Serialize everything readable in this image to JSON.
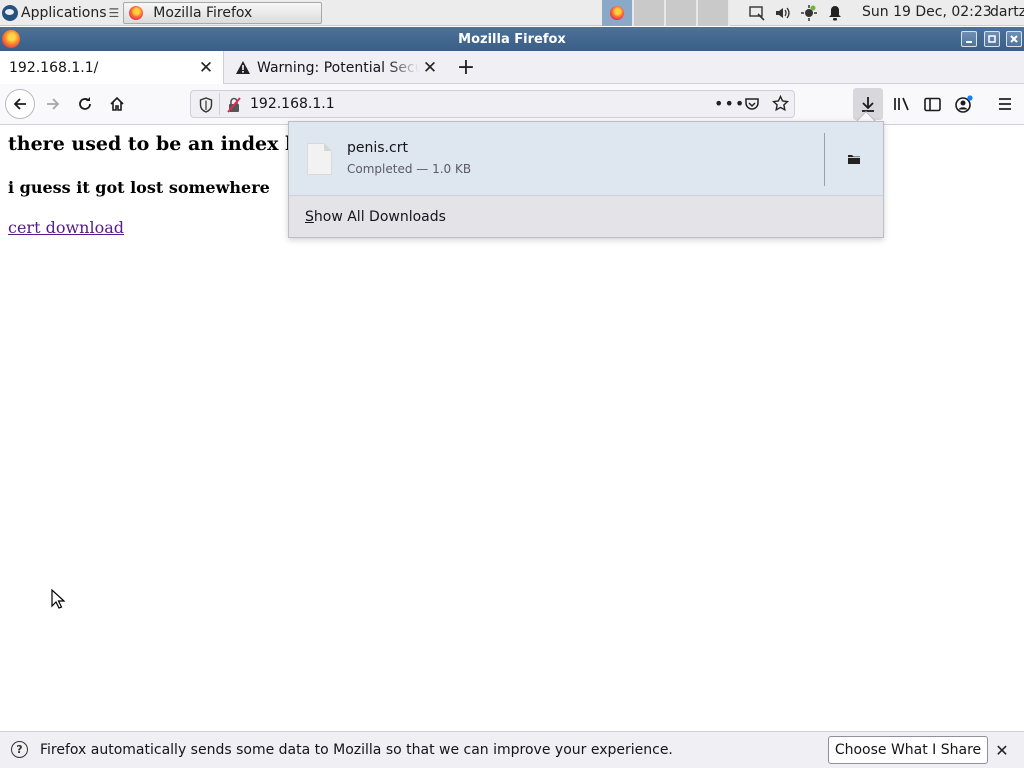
{
  "panel": {
    "applications_label": "Applications",
    "task_title": "Mozilla Firefox",
    "clock": "Sun 19 Dec, 02:23",
    "user": "dartz"
  },
  "window": {
    "title": "Mozilla Firefox"
  },
  "tabs": [
    {
      "label": "192.168.1.1/",
      "active": true
    },
    {
      "label": "Warning: Potential Security Risk Ahead",
      "active": false
    }
  ],
  "urlbar": {
    "value": "192.168.1.1"
  },
  "page": {
    "heading": "there used to be an index here",
    "subheading": "i guess it got lost somewhere",
    "link": "cert download"
  },
  "downloads": {
    "file_name": "penis.crt",
    "status": "Completed — 1.0 KB",
    "show_all_pre": "",
    "show_all_accel": "S",
    "show_all_rest": "how All Downloads"
  },
  "notification": {
    "text": "Firefox automatically sends some data to Mozilla so that we can improve your experience.",
    "button": "Choose What I Share"
  },
  "icons": {
    "system_menu": "xfce-logo-icon",
    "firefox": "firefox-icon",
    "back": "back-arrow-icon",
    "forward": "forward-arrow-icon",
    "reload": "reload-icon",
    "home": "home-icon",
    "tracking": "shield-icon",
    "insecure": "insecure-lock-icon",
    "page_actions": "more-icon",
    "pocket": "pocket-icon",
    "bookmark": "star-icon",
    "downloads": "download-icon",
    "library": "library-icon",
    "sidebar": "sidebar-icon",
    "account": "account-icon",
    "menu": "hamburger-icon",
    "file": "file-icon",
    "folder": "folder-icon",
    "info": "info-icon"
  }
}
